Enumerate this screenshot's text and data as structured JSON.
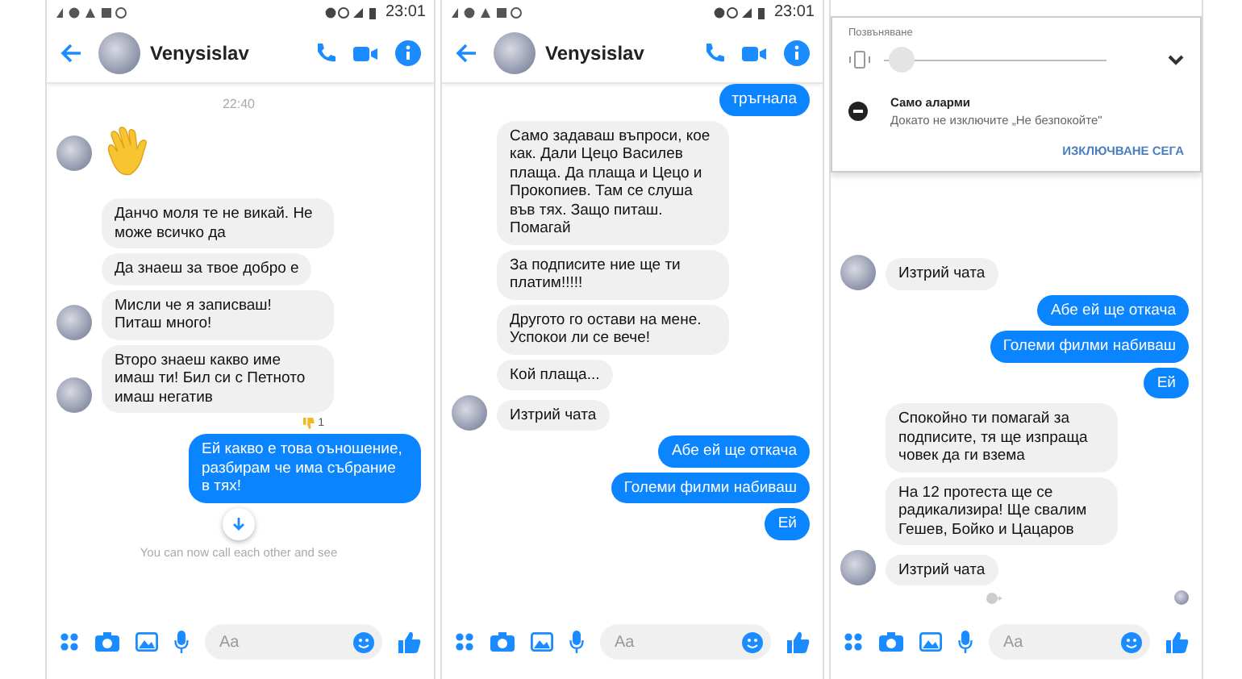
{
  "screens": [
    {
      "status_bar": {
        "time": "23:01"
      },
      "header": {
        "name": "Venysislav"
      },
      "messages": [
        {
          "kind": "timestamp",
          "text": "22:40"
        },
        {
          "kind": "emoji",
          "avatar": true
        },
        {
          "kind": "received",
          "text": "Данчо моля те не викай. Не може всичко да",
          "avatar": false
        },
        {
          "kind": "received",
          "text": "Да знаеш за твое добро е",
          "avatar": false
        },
        {
          "kind": "received",
          "text": "Мисли че я записваш! Питаш много!",
          "avatar": true
        },
        {
          "kind": "received",
          "text": "Второ знаеш какво име имаш ти! Бил си с Петното имаш негатив",
          "avatar": true,
          "reaction": "1"
        },
        {
          "kind": "sent",
          "text": "Ей какво е това оъношение, разбирам че има събрание в тях!"
        },
        {
          "kind": "scroll_down"
        },
        {
          "kind": "notice",
          "text": "You can now call each other and see"
        }
      ],
      "composer": {
        "placeholder": "Aa"
      }
    },
    {
      "status_bar": {
        "time": "23:01"
      },
      "header": {
        "name": "Venysislav"
      },
      "messages": [
        {
          "kind": "sent",
          "text": "тръгнала"
        },
        {
          "kind": "received",
          "text": "Само задаваш въпроси, кое как. Дали Цецо Василев плаща. Да плаща и Цецо и Прокопиев. Там се слуша във тях. Защо питаш. Помагай",
          "avatar": false
        },
        {
          "kind": "received",
          "text": "За подписите ние ще ти платим!!!!!",
          "avatar": false
        },
        {
          "kind": "received",
          "text": "Другото го остави на мене. Успокои ли се вече!",
          "avatar": false
        },
        {
          "kind": "received",
          "text": "Кой плаща...",
          "avatar": false
        },
        {
          "kind": "received",
          "text": "Изтрий чата",
          "avatar": true
        },
        {
          "kind": "sent",
          "text": "Абе ей ще откача"
        },
        {
          "kind": "sent",
          "text": "Големи филми набиваш"
        },
        {
          "kind": "sent",
          "text": "Ей"
        }
      ],
      "composer": {
        "placeholder": "Aa"
      }
    },
    {
      "quick_settings": {
        "label": "Позвъняване",
        "level": 0.02,
        "mode_title": "Само аларми",
        "mode_text": "Докато не изключите „Не безпокойте\"",
        "action": "ИЗКЛЮЧВАНЕ СЕГА"
      },
      "messages": [
        {
          "kind": "received",
          "text": "Изтрий чата",
          "avatar": true
        },
        {
          "kind": "sent",
          "text": "Абе ей ще откача"
        },
        {
          "kind": "sent",
          "text": "Големи филми набиваш"
        },
        {
          "kind": "sent",
          "text": "Ей"
        },
        {
          "kind": "received",
          "text": "Спокойно ти помагай за подписите, тя ще изпраща човек да ги вземa",
          "avatar": false
        },
        {
          "kind": "received",
          "text": "На 12 протеста ще се радикализира! Ще свалим Гешев, Бойко и Цацаров",
          "avatar": false
        },
        {
          "kind": "received",
          "text": "Изтрий чата",
          "avatar": true
        },
        {
          "kind": "seen"
        }
      ],
      "composer": {
        "placeholder": "Aa"
      }
    }
  ]
}
